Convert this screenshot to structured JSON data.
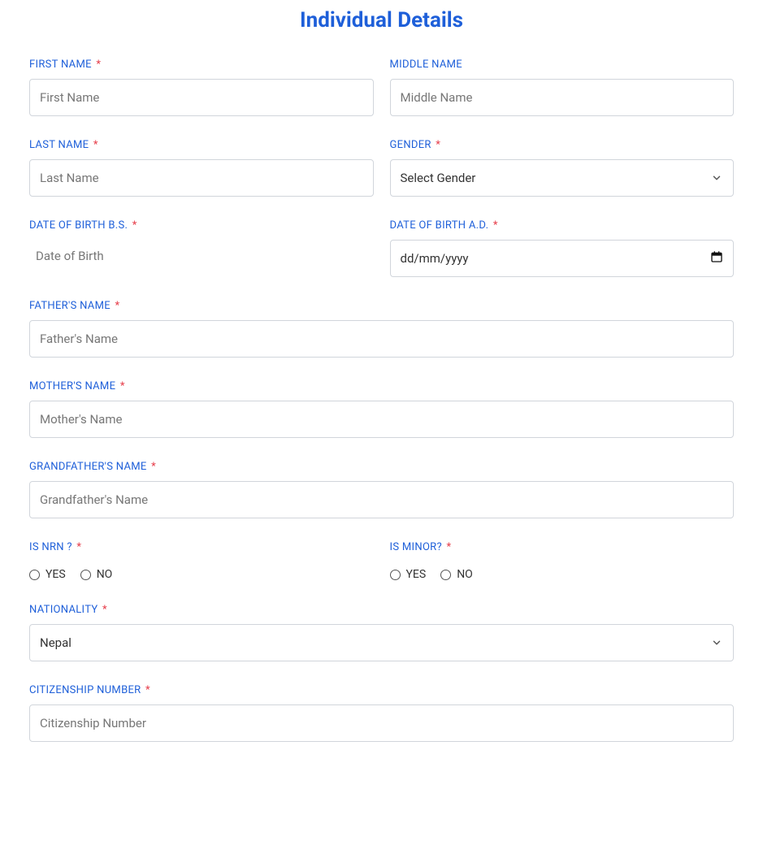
{
  "title": "Individual Details",
  "required_marker": "*",
  "fields": {
    "first_name": {
      "label": "FIRST NAME",
      "placeholder": "First Name",
      "required": true
    },
    "middle_name": {
      "label": "MIDDLE NAME",
      "placeholder": "Middle Name",
      "required": false
    },
    "last_name": {
      "label": "LAST NAME",
      "placeholder": "Last Name",
      "required": true
    },
    "gender": {
      "label": "GENDER",
      "selected": "Select Gender",
      "required": true
    },
    "dob_bs": {
      "label": "DATE OF BIRTH B.S.",
      "placeholder": "Date of Birth",
      "required": true
    },
    "dob_ad": {
      "label": "DATE OF BIRTH A.D.",
      "placeholder": "dd/mm/yyyy",
      "required": true
    },
    "father_name": {
      "label": "FATHER'S NAME",
      "placeholder": "Father's Name",
      "required": true
    },
    "mother_name": {
      "label": "MOTHER'S NAME",
      "placeholder": "Mother's Name",
      "required": true
    },
    "grandfather_name": {
      "label": "GRANDFATHER'S NAME",
      "placeholder": "Grandfather's Name",
      "required": true
    },
    "is_nrn": {
      "label": "IS NRN ?",
      "required": true,
      "options": [
        "YES",
        "NO"
      ]
    },
    "is_minor": {
      "label": "IS MINOR?",
      "required": true,
      "options": [
        "YES",
        "NO"
      ]
    },
    "nationality": {
      "label": "NATIONALITY",
      "selected": "Nepal",
      "required": true
    },
    "citizenship_number": {
      "label": "CITIZENSHIP NUMBER",
      "placeholder": "Citizenship Number",
      "required": true
    }
  }
}
